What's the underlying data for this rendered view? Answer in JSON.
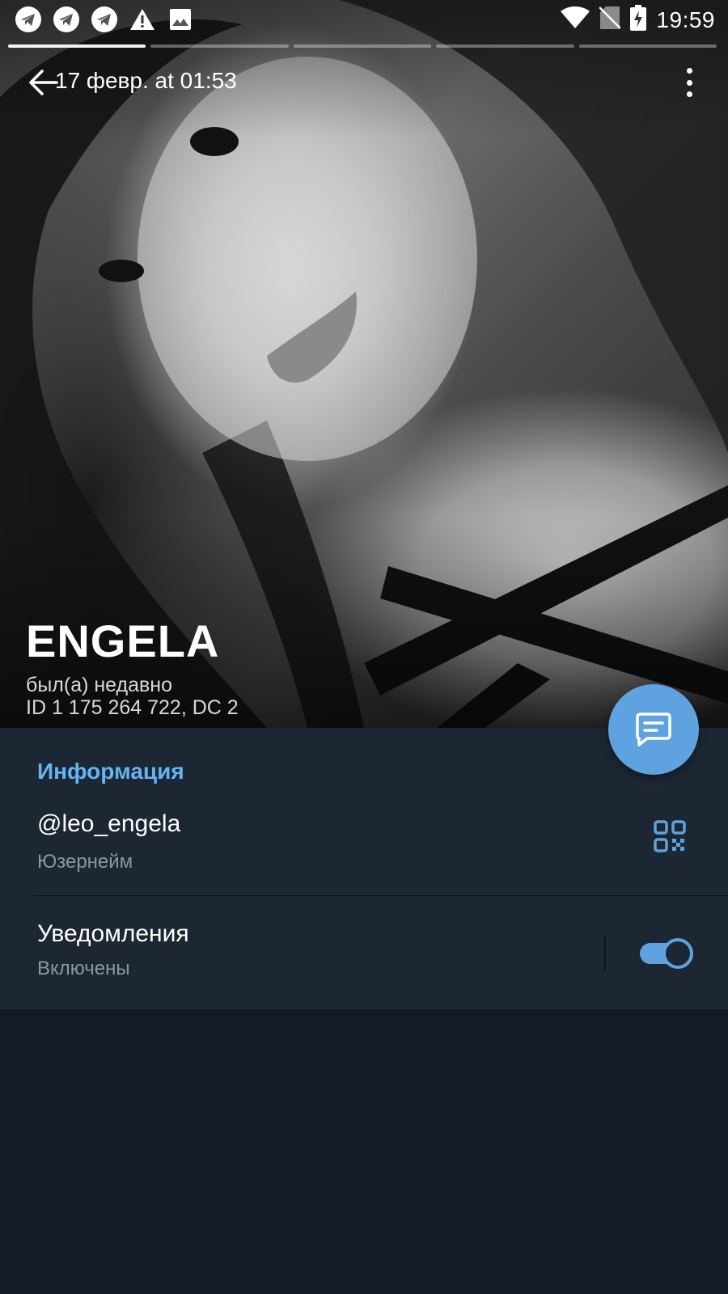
{
  "status_bar": {
    "time": "19:59",
    "left_icons": [
      "telegram-icon",
      "telegram-icon",
      "telegram-icon",
      "warning-icon",
      "image-icon"
    ],
    "right_icons": [
      "wifi-icon",
      "no-sim-icon",
      "battery-charging-icon"
    ]
  },
  "story": {
    "segments": 5,
    "active_segment": 1
  },
  "header": {
    "date": "17 февр. at 01:53"
  },
  "profile": {
    "name": "ENGELA",
    "status": "был(а) недавно",
    "id_line": "ID 1 175 264 722, DC 2"
  },
  "info": {
    "section_title": "Информация",
    "username_value": "@leo_engela",
    "username_label": "Юзернейм",
    "notifications_title": "Уведомления",
    "notifications_state": "Включены",
    "notifications_enabled": true
  },
  "colors": {
    "accent": "#5ea3e0",
    "section_title": "#64b4f2",
    "panel_bg": "#1d2633",
    "page_bg": "#151b25",
    "secondary_text": "#8a96a3"
  }
}
